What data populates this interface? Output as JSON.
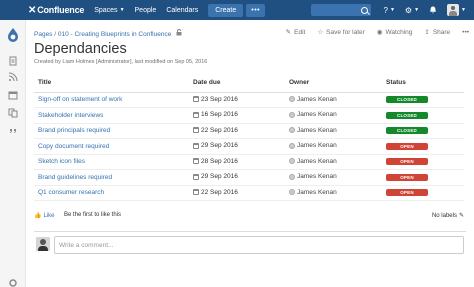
{
  "nav": {
    "logo": "Confluence",
    "spaces": "Spaces",
    "people": "People",
    "calendars": "Calendars",
    "create": "Create",
    "more": "•••",
    "help_icon": "?",
    "settings_icon": "⚙",
    "notif_icon": "🔔"
  },
  "breadcrumb": {
    "items": [
      "Pages",
      "010 - Creating Blueprints in Confluence"
    ],
    "sep": " / "
  },
  "actions": {
    "edit": "Edit",
    "save_for_later": "Save for later",
    "watching": "Watching",
    "share": "Share"
  },
  "page": {
    "title": "Dependancies",
    "byline": "Created by Liam Holmes [Administrator], last modified on Sep 05, 2016"
  },
  "table": {
    "headers": [
      "Title",
      "Date due",
      "Owner",
      "Status"
    ],
    "rows": [
      {
        "title": "Sign-off on statement of work",
        "date": "23 Sep 2016",
        "owner": "James Kenan",
        "status": "CLOSED"
      },
      {
        "title": "Stakeholder interviews",
        "date": "16 Sep 2016",
        "owner": "James Kenan",
        "status": "CLOSED"
      },
      {
        "title": "Brand principals required",
        "date": "22 Sep 2016",
        "owner": "James Kenan",
        "status": "CLOSED"
      },
      {
        "title": "Copy document required",
        "date": "29 Sep 2016",
        "owner": "James Kenan",
        "status": "OPEN"
      },
      {
        "title": "Sketch icon files",
        "date": "28 Sep 2016",
        "owner": "James Kenan",
        "status": "OPEN"
      },
      {
        "title": "Brand guidelines required",
        "date": "29 Sep 2016",
        "owner": "James Kenan",
        "status": "OPEN"
      },
      {
        "title": "Q1 consumer research",
        "date": "22 Sep 2016",
        "owner": "James Kenan",
        "status": "OPEN"
      }
    ]
  },
  "footer": {
    "like": "Like",
    "first_to_like": "Be the first to like this",
    "labels": "No labels",
    "comment_placeholder": "Write a comment..."
  },
  "colors": {
    "nav_bg": "#205081",
    "link": "#3572b0",
    "closed": "#14892c",
    "open": "#d04437"
  }
}
